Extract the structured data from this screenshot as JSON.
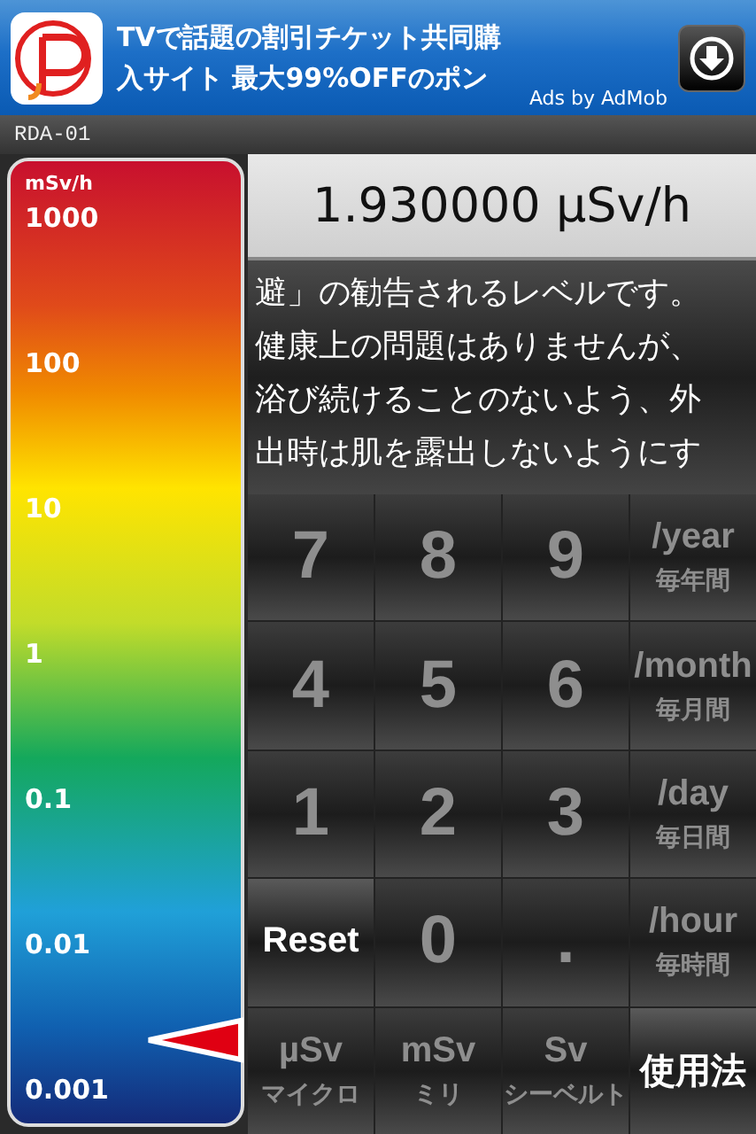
{
  "ad": {
    "lines": [
      "TVで話題の割引チケット共同購",
      "入サイト 最大99%OFFのポン"
    ],
    "attribution": "Ads by AdMob"
  },
  "device": {
    "name": "RDA-01"
  },
  "scale": {
    "unit": "mSv/h",
    "ticks": [
      "1000",
      "100",
      "10",
      "1",
      "0.1",
      "0.01",
      "0.001"
    ]
  },
  "reading": "1.930000 µSv/h",
  "message": [
    "避」の勧告されるレベルです。",
    "健康上の問題はありませんが、",
    "浴び続けることのないよう、外",
    "出時は肌を露出しないようにす"
  ],
  "keys": [
    {
      "kind": "digit",
      "label": "7"
    },
    {
      "kind": "digit",
      "label": "8"
    },
    {
      "kind": "digit",
      "label": "9"
    },
    {
      "kind": "unit",
      "label": "/year",
      "sub": "毎年間"
    },
    {
      "kind": "digit",
      "label": "4"
    },
    {
      "kind": "digit",
      "label": "5"
    },
    {
      "kind": "digit",
      "label": "6"
    },
    {
      "kind": "unit",
      "label": "/month",
      "sub": "毎月間"
    },
    {
      "kind": "digit",
      "label": "1"
    },
    {
      "kind": "digit",
      "label": "2"
    },
    {
      "kind": "digit",
      "label": "3"
    },
    {
      "kind": "unit",
      "label": "/day",
      "sub": "毎日間"
    },
    {
      "kind": "action",
      "label": "Reset"
    },
    {
      "kind": "digit",
      "label": "0"
    },
    {
      "kind": "digit",
      "label": "."
    },
    {
      "kind": "unit",
      "label": "/hour",
      "sub": "毎時間"
    },
    {
      "kind": "unit",
      "label": "µSv",
      "sub": "マイクロ"
    },
    {
      "kind": "unit",
      "label": "mSv",
      "sub": "ミリ"
    },
    {
      "kind": "unit",
      "label": "Sv",
      "sub": "シーベルト"
    },
    {
      "kind": "action",
      "label": "使用法"
    }
  ]
}
